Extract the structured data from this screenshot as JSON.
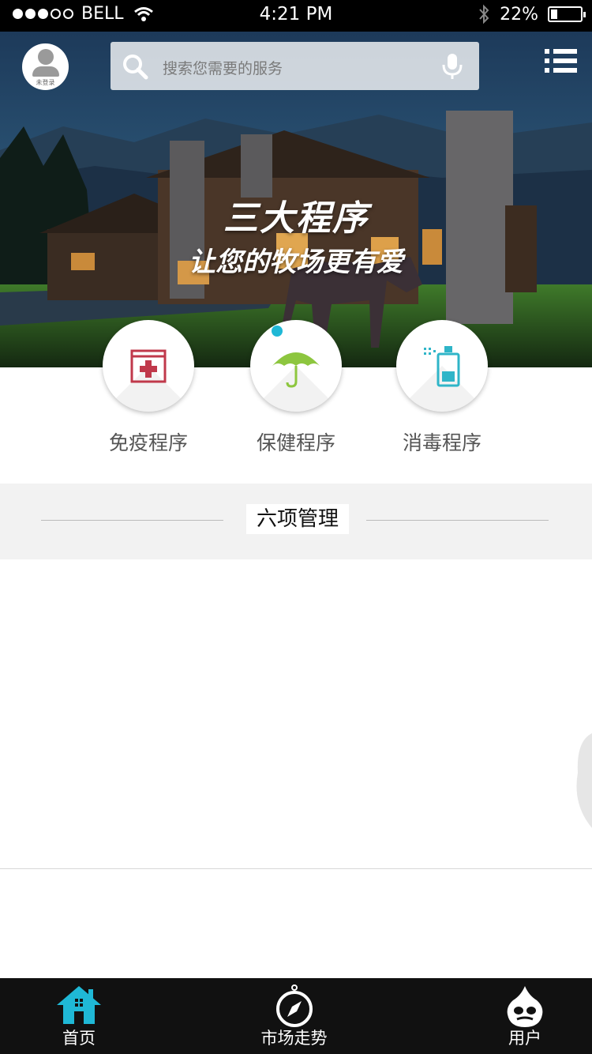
{
  "status_bar": {
    "carrier": "BELL",
    "time": "4:21 PM",
    "battery": "22%",
    "signal_filled": 3,
    "signal_total": 5,
    "battery_level": 0.22
  },
  "header": {
    "avatar_label": "未登录",
    "search_placeholder": "搜索您需要的服务",
    "icons": {
      "avatar": "user-icon",
      "search": "search-icon",
      "mic": "microphone-icon",
      "menu": "list-menu-icon"
    }
  },
  "banner": {
    "title": "三大程序",
    "subtitle": "让您的牧场更有爱",
    "slides_total": 3,
    "active_slide": 1,
    "accent_color": "#1fb8d6"
  },
  "programs": [
    {
      "label": "免疫程序",
      "icon": "medical-kit-icon",
      "color": "#c0394b"
    },
    {
      "label": "保健程序",
      "icon": "umbrella-icon",
      "color": "#8dc63f"
    },
    {
      "label": "消毒程序",
      "icon": "spray-bottle-icon",
      "color": "#2fb5c8"
    }
  ],
  "section": {
    "title": "六项管理"
  },
  "tabbar": {
    "tabs": [
      {
        "label": "首页",
        "icon": "home-icon",
        "active": true
      },
      {
        "label": "市场走势",
        "icon": "compass-icon",
        "active": false
      },
      {
        "label": "用户",
        "icon": "drupal-drop-icon",
        "active": false
      }
    ],
    "active_color": "#1fb8d6"
  }
}
